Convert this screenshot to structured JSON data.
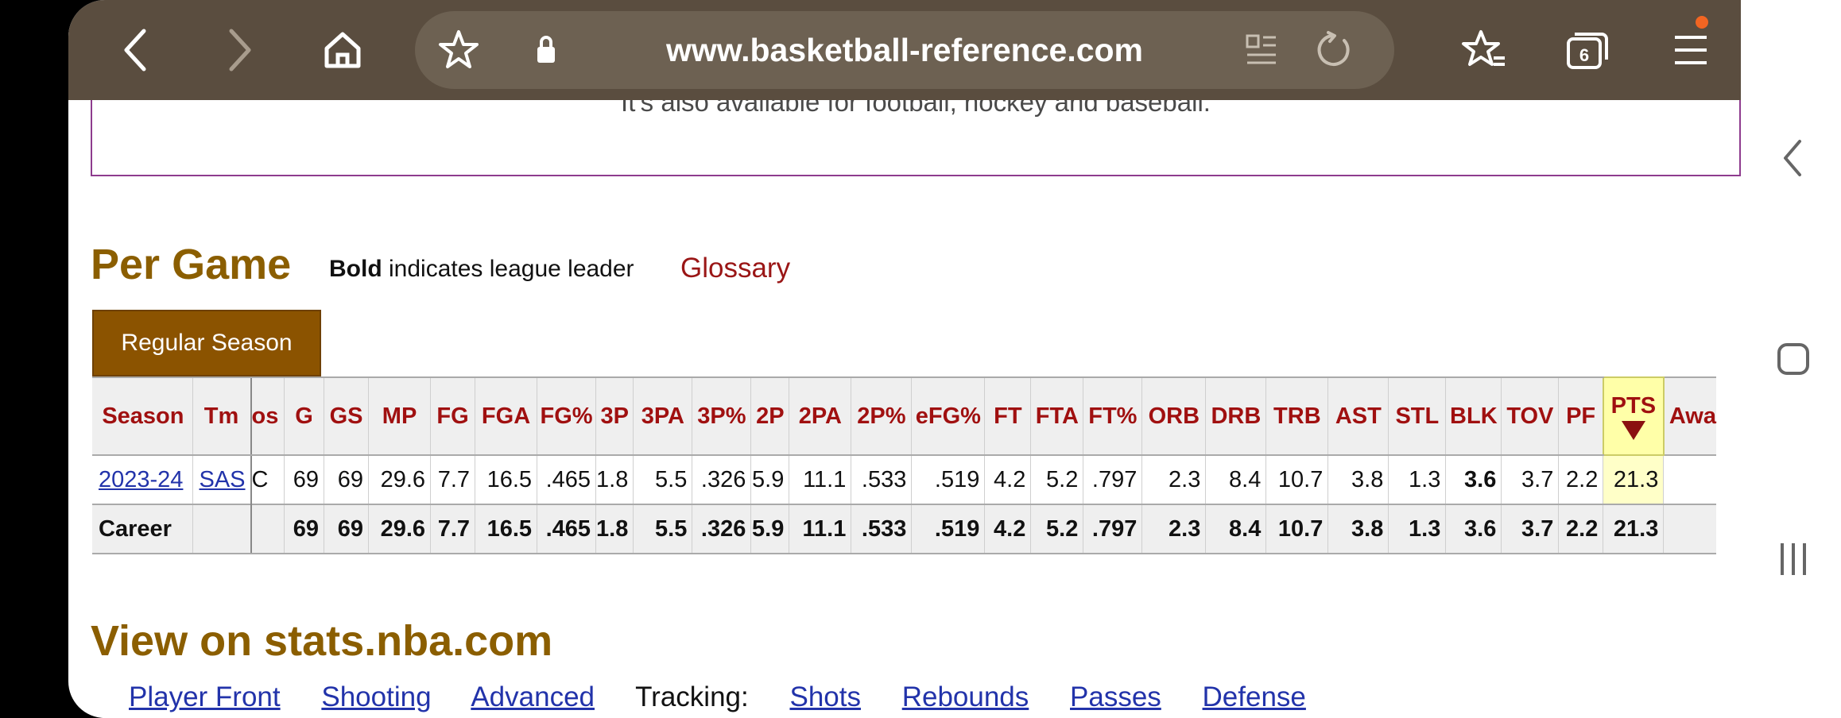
{
  "browser": {
    "url": "www.basketball-reference.com",
    "tab_count": "6",
    "icons": [
      "back-icon",
      "forward-icon",
      "home-icon",
      "bookmark-star-icon",
      "lock-icon",
      "reader-icon",
      "reload-icon",
      "bookmarks-icon",
      "tabs-icon",
      "menu-icon"
    ],
    "accent": "#f26522"
  },
  "promo": {
    "text": "It's also available for football, hockey and baseball."
  },
  "section": {
    "title": "Per Game",
    "note_bold": "Bold",
    "note_rest": " indicates league leader",
    "glossary": "Glossary",
    "tab": "Regular Season"
  },
  "table": {
    "headers": [
      "Season",
      "Tm",
      "os",
      "G",
      "GS",
      "MP",
      "FG",
      "FGA",
      "FG%",
      "3P",
      "3PA",
      "3P%",
      "2P",
      "2PA",
      "2P%",
      "eFG%",
      "FT",
      "FTA",
      "FT%",
      "ORB",
      "DRB",
      "TRB",
      "AST",
      "STL",
      "BLK",
      "TOV",
      "PF",
      "PTS",
      "Awa"
    ],
    "row": {
      "season": "2023-24",
      "tm": "SAS",
      "pos": "C",
      "stats": [
        "69",
        "69",
        "29.6",
        "7.7",
        "16.5",
        ".465",
        "1.8",
        "5.5",
        ".326",
        "5.9",
        "11.1",
        ".533",
        ".519",
        "4.2",
        "5.2",
        ".797",
        "2.3",
        "8.4",
        "10.7",
        "3.8",
        "1.3",
        "3.6",
        "3.7",
        "2.2",
        "21.3"
      ]
    },
    "career": {
      "label": "Career",
      "stats": [
        "69",
        "69",
        "29.6",
        "7.7",
        "16.5",
        ".465",
        "1.8",
        "5.5",
        ".326",
        "5.9",
        "11.1",
        ".533",
        ".519",
        "4.2",
        "5.2",
        ".797",
        "2.3",
        "8.4",
        "10.7",
        "3.8",
        "1.3",
        "3.6",
        "3.7",
        "2.2",
        "21.3"
      ]
    }
  },
  "nba": {
    "title": "View on stats.nba.com",
    "links": {
      "front": "Player Front",
      "shooting": "Shooting",
      "advanced": "Advanced",
      "tracking": "Tracking:",
      "shots": "Shots",
      "rebounds": "Rebounds",
      "passes": "Passes",
      "defense": "Defense"
    }
  }
}
